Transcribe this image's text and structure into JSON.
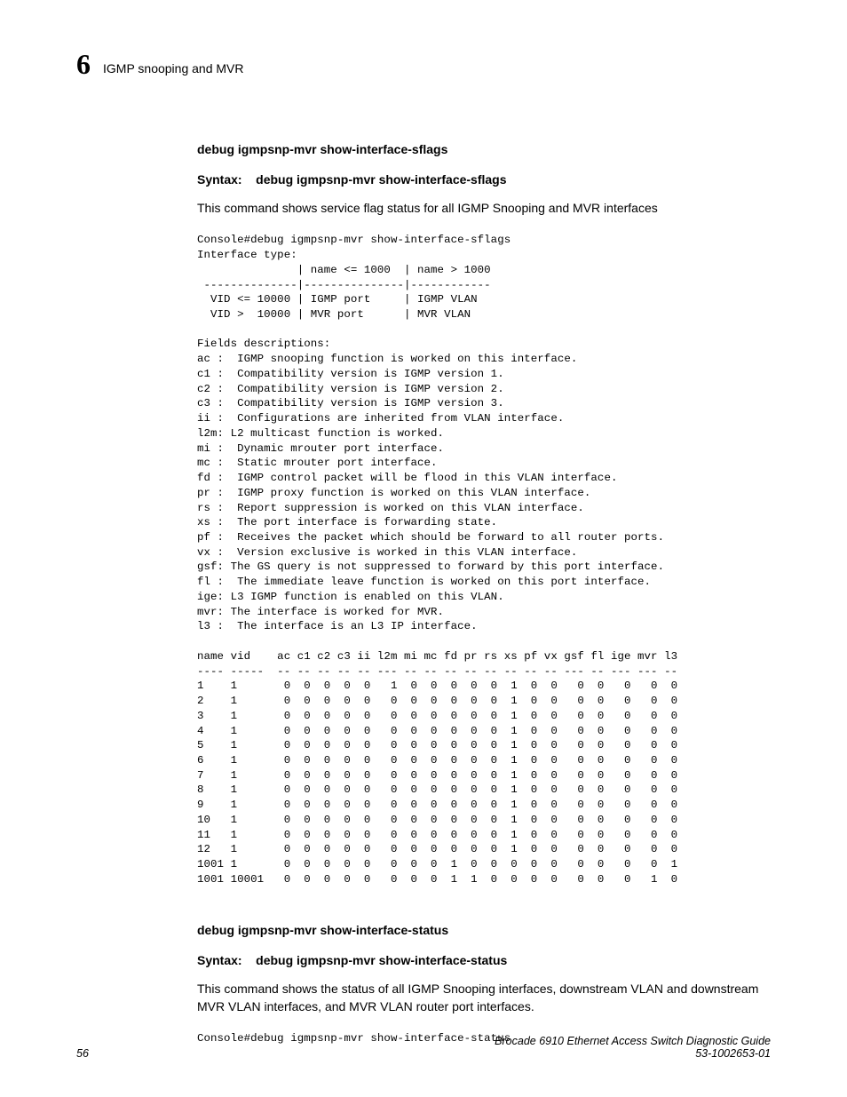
{
  "header": {
    "chapter_number": "6",
    "chapter_title": "IGMP snooping and MVR"
  },
  "section1": {
    "heading": "debug igmpsnp-mvr show-interface-sflags",
    "syntax_label": "Syntax:",
    "syntax_cmd": "debug igmpsnp-mvr show-interface-sflags",
    "description": "This command shows service flag status for all IGMP Snooping and MVR interfaces",
    "console": "Console#debug igmpsnp-mvr show-interface-sflags\nInterface type:\n               | name <= 1000  | name > 1000\n --------------|---------------|------------\n  VID <= 10000 | IGMP port     | IGMP VLAN\n  VID >  10000 | MVR port      | MVR VLAN\n\nFields descriptions:\nac :  IGMP snooping function is worked on this interface.\nc1 :  Compatibility version is IGMP version 1.\nc2 :  Compatibility version is IGMP version 2.\nc3 :  Compatibility version is IGMP version 3.\nii :  Configurations are inherited from VLAN interface.\nl2m: L2 multicast function is worked.\nmi :  Dynamic mrouter port interface.\nmc :  Static mrouter port interface.\nfd :  IGMP control packet will be flood in this VLAN interface.\npr :  IGMP proxy function is worked on this VLAN interface.\nrs :  Report suppression is worked on this VLAN interface.\nxs :  The port interface is forwarding state.\npf :  Receives the packet which should be forward to all router ports.\nvx :  Version exclusive is worked in this VLAN interface.\ngsf: The GS query is not suppressed to forward by this port interface.\nfl :  The immediate leave function is worked on this port interface.\nige: L3 IGMP function is enabled on this VLAN.\nmvr: The interface is worked for MVR.\nl3 :  The interface is an L3 IP interface.\n\nname vid    ac c1 c2 c3 ii l2m mi mc fd pr rs xs pf vx gsf fl ige mvr l3\n---- -----  -- -- -- -- -- --- -- -- -- -- -- -- -- -- --- -- --- --- --\n1    1       0  0  0  0  0   1  0  0  0  0  0  1  0  0   0  0   0   0  0\n2    1       0  0  0  0  0   0  0  0  0  0  0  1  0  0   0  0   0   0  0\n3    1       0  0  0  0  0   0  0  0  0  0  0  1  0  0   0  0   0   0  0\n4    1       0  0  0  0  0   0  0  0  0  0  0  1  0  0   0  0   0   0  0\n5    1       0  0  0  0  0   0  0  0  0  0  0  1  0  0   0  0   0   0  0\n6    1       0  0  0  0  0   0  0  0  0  0  0  1  0  0   0  0   0   0  0\n7    1       0  0  0  0  0   0  0  0  0  0  0  1  0  0   0  0   0   0  0\n8    1       0  0  0  0  0   0  0  0  0  0  0  1  0  0   0  0   0   0  0\n9    1       0  0  0  0  0   0  0  0  0  0  0  1  0  0   0  0   0   0  0\n10   1       0  0  0  0  0   0  0  0  0  0  0  1  0  0   0  0   0   0  0\n11   1       0  0  0  0  0   0  0  0  0  0  0  1  0  0   0  0   0   0  0\n12   1       0  0  0  0  0   0  0  0  0  0  0  1  0  0   0  0   0   0  0\n1001 1       0  0  0  0  0   0  0  0  1  0  0  0  0  0   0  0   0   0  1\n1001 10001   0  0  0  0  0   0  0  0  1  1  0  0  0  0   0  0   0   1  0"
  },
  "section2": {
    "heading": "debug igmpsnp-mvr show-interface-status",
    "syntax_label": "Syntax:",
    "syntax_cmd": "debug igmpsnp-mvr show-interface-status",
    "description": "This command shows the status of all IGMP Snooping interfaces, downstream VLAN and downstream MVR VLAN interfaces, and MVR VLAN router port interfaces.",
    "console": "Console#debug igmpsnp-mvr show-interface-status"
  },
  "footer": {
    "page_number": "56",
    "doc_title": "Brocade 6910 Ethernet Access Switch Diagnostic Guide",
    "doc_number": "53-1002653-01"
  }
}
